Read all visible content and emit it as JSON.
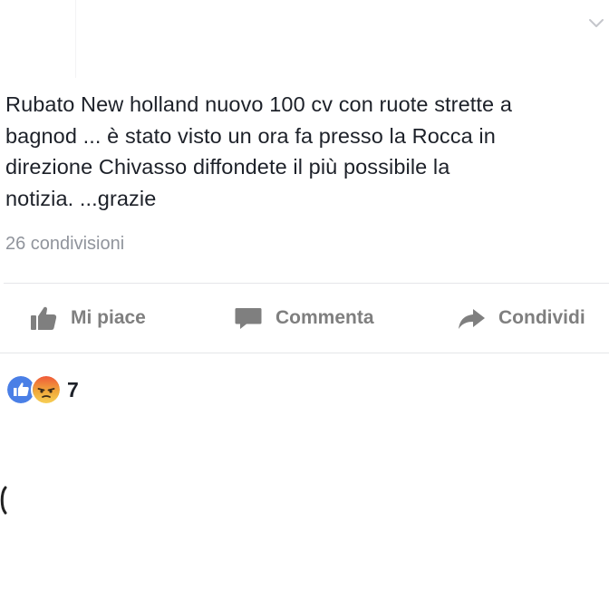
{
  "post": {
    "text_lines": [
      "Rubato New holland nuovo 100 cv con ruote strette a",
      "bagnod ... è stato visto un ora fa presso la Rocca in",
      "direzione Chivasso diffondete il più possibile la",
      "notizia. ...grazie"
    ],
    "shares": "26 condivisioni"
  },
  "actions": {
    "like": {
      "label": "Mi piace",
      "icon": "thumbs-up-icon"
    },
    "comment": {
      "label": "Commenta",
      "icon": "speech-bubble-icon"
    },
    "share": {
      "label": "Condividi",
      "icon": "share-arrow-icon"
    }
  },
  "reactions": {
    "icons": [
      "like-reaction-icon",
      "angry-reaction-icon"
    ],
    "count": "7"
  },
  "colors": {
    "text": "#1d2129",
    "muted": "#90949c",
    "action_gray": "#7f7f7f",
    "like_blue": "#4a7fe6",
    "angry_orange": "#f0a73a",
    "divider": "#e5e6e9"
  }
}
